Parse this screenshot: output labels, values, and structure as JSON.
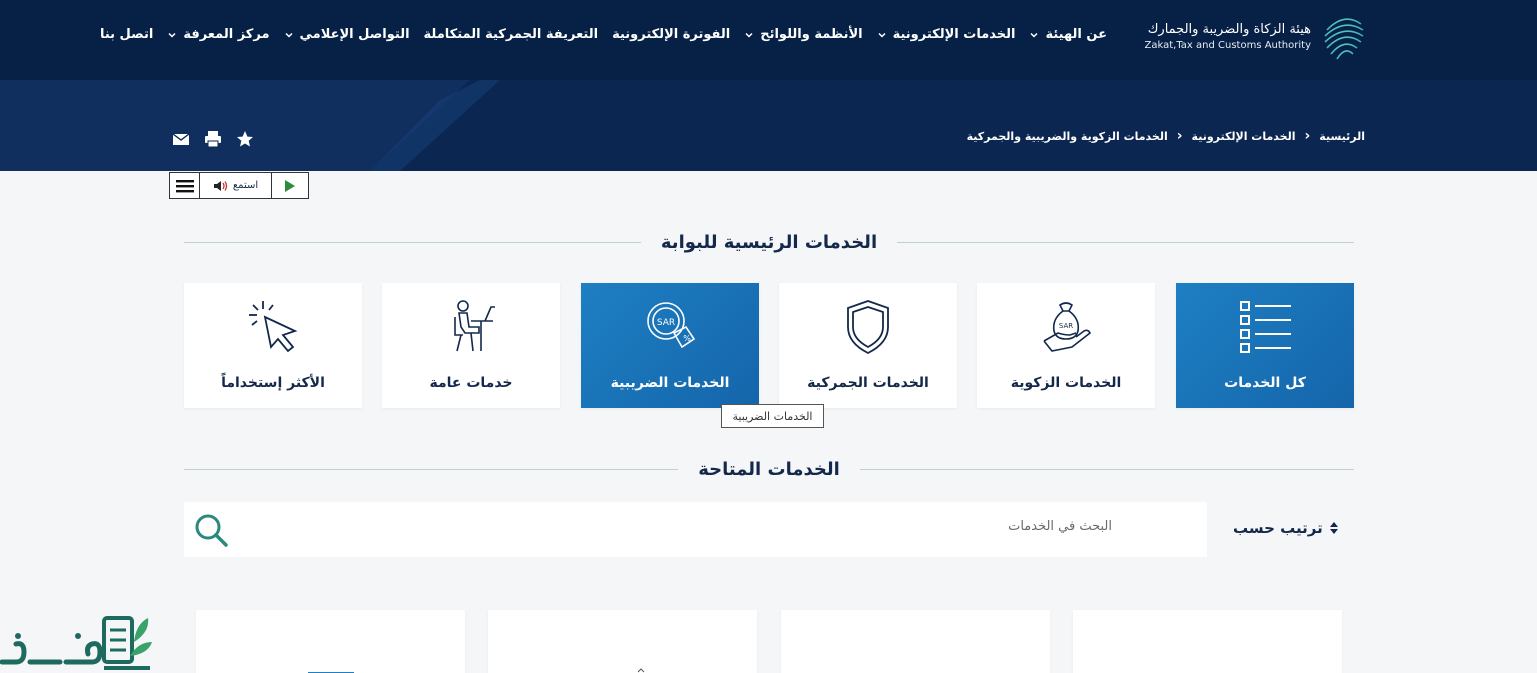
{
  "header": {
    "logo_ar": "هيئة الزكاة والضريبة والجمارك",
    "logo_en": "Zakat,Tax and Customs Authority",
    "nav": [
      {
        "label": "عن الهيئة",
        "has_dropdown": true
      },
      {
        "label": "الخدمات الإلكترونية",
        "has_dropdown": true
      },
      {
        "label": "الأنظمة واللوائح",
        "has_dropdown": true
      },
      {
        "label": "الفوترة الإلكترونية",
        "has_dropdown": false
      },
      {
        "label": "التعريفة الجمركية المتكاملة",
        "has_dropdown": false
      },
      {
        "label": "التواصل الإعلامي",
        "has_dropdown": true
      },
      {
        "label": "مركز المعرفة",
        "has_dropdown": true
      },
      {
        "label": "اتصل بنا",
        "has_dropdown": false
      }
    ]
  },
  "breadcrumb": {
    "items": [
      "الرئيسية",
      "الخدمات الإلكترونية",
      "الخدمات الزكوية والضريبية والجمركية"
    ]
  },
  "tools": {
    "icons": [
      "star-icon",
      "print-icon",
      "mail-icon"
    ]
  },
  "listen_widget": {
    "label": "استمع"
  },
  "main_services": {
    "title": "الخدمات الرئيسية للبوابة",
    "cards": [
      {
        "label": "كل الخدمات",
        "icon": "list-icon",
        "highlighted": true
      },
      {
        "label": "الخدمات الزكوية",
        "icon": "zakat-bag-icon",
        "highlighted": false
      },
      {
        "label": "الخدمات الجمركية",
        "icon": "shield-icon",
        "highlighted": false
      },
      {
        "label": "الخدمات الضريبية",
        "icon": "sar-tax-icon",
        "highlighted": true
      },
      {
        "label": "خدمات عامة",
        "icon": "person-desk-icon",
        "highlighted": false
      },
      {
        "label": "الأكثر إستخداماً",
        "icon": "cursor-click-icon",
        "highlighted": false
      }
    ],
    "tooltip": "الخدمات الضريبية"
  },
  "available_services": {
    "title": "الخدمات المتاحة",
    "search_placeholder": "البحث في الخدمات",
    "sort_label": "ترتيب حسب"
  },
  "watermark": {
    "text": "فكرة"
  },
  "colors": {
    "navy": "#062145",
    "accent_blue": "#1e7fc3",
    "teal": "#2b8a7e"
  }
}
